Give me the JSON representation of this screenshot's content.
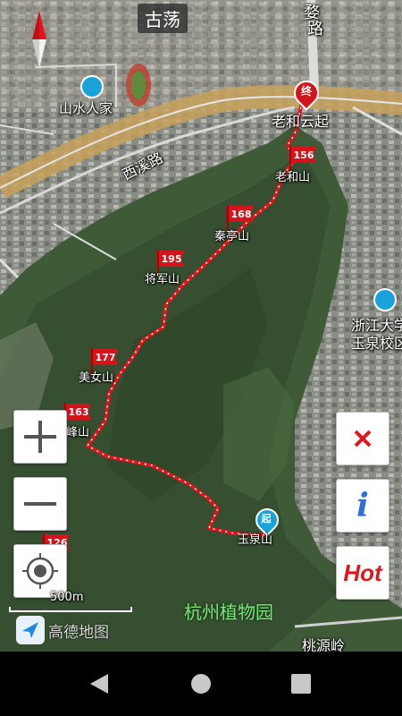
{
  "map": {
    "place_top": "古荡",
    "road_top_vertical": "路",
    "road_top_vertical_2": "婺",
    "road_xixi": "西溪路",
    "poi_shanshui": "山水人家",
    "poi_zhejiang_u_1": "浙江大学",
    "poi_zhejiang_u_2": "玉泉校区",
    "poi_botanical_garden": "杭州植物园",
    "road_taoyuanling": "桃源岭",
    "start_badge": "起",
    "end_badge": "终",
    "end_label": "老和云起",
    "start_label": "玉泉山",
    "summits": [
      {
        "elev": "156",
        "name": "老和山"
      },
      {
        "elev": "168",
        "name": "秦亭山"
      },
      {
        "elev": "195",
        "name": "将军山"
      },
      {
        "elev": "177",
        "name": "美女山"
      },
      {
        "elev": "163",
        "name": "峰山"
      },
      {
        "elev": "126",
        "name": ""
      }
    ],
    "route_color": "#e0141c"
  },
  "controls": {
    "zoom_in": "+",
    "zoom_out": "−",
    "close": "×",
    "info": "i",
    "hot": "Hot"
  },
  "scale": {
    "label": "500m"
  },
  "brand": {
    "name": "高德地图"
  }
}
